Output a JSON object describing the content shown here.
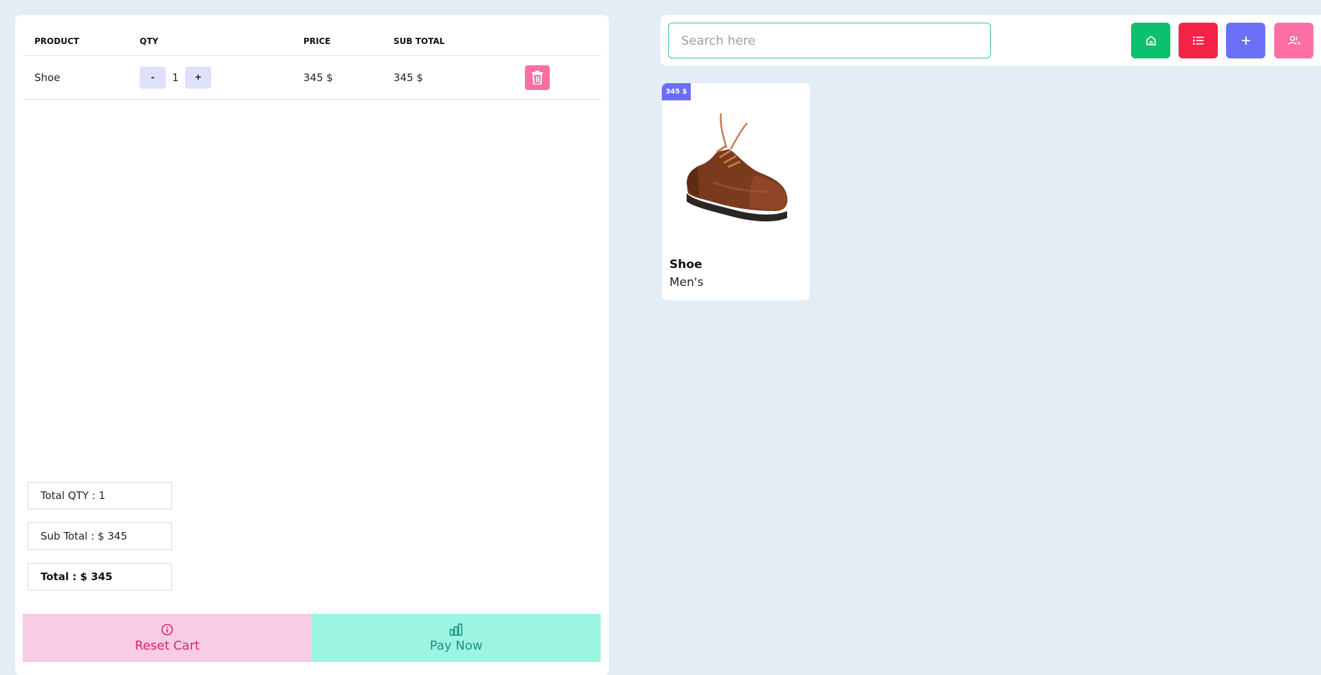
{
  "cart": {
    "headers": {
      "product": "PRODUCT",
      "qty": "QTY",
      "price": "PRICE",
      "subtotal": "SUB TOTAL"
    },
    "rows": [
      {
        "product": "Shoe",
        "minus": "-",
        "qty": "1",
        "plus": "+",
        "price": "345 $",
        "subtotal": "345 $"
      }
    ],
    "summary": {
      "total_qty": "Total QTY : 1",
      "sub_total": "Sub Total : $ 345",
      "total": "Total : $ 345"
    },
    "actions": {
      "reset": "Reset Cart",
      "pay": "Pay Now"
    }
  },
  "search": {
    "placeholder": "Search here"
  },
  "toolbar": {
    "buttons": [
      {
        "icon": "home-icon",
        "color": "#0bc16d"
      },
      {
        "icon": "list-icon",
        "color": "#f52248"
      },
      {
        "icon": "plus-icon",
        "color": "#6b70f7"
      },
      {
        "icon": "users-icon",
        "color": "#fc6ea4"
      }
    ]
  },
  "products": [
    {
      "badge": "345 $",
      "name": "Shoe",
      "category": "Men's"
    }
  ],
  "colors": {
    "background": "#e3edf5",
    "reset_bg": "#f9cce6",
    "pay_bg": "#9bf5e2",
    "trash": "#fb6fa2",
    "badge": "#6c6ff5"
  }
}
